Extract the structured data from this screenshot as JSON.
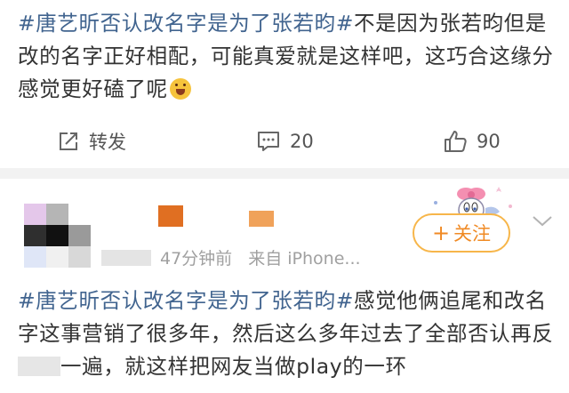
{
  "post1": {
    "topic": "#唐艺昕否认改名字是为了张若昀#",
    "body": "不是因为张若昀但是改的名字正好相配，可能真爱就是这样吧，这巧合这缘分感觉更好磕了呢",
    "emoji": "grinning-face-emoji"
  },
  "actions": {
    "repost_label": "转发",
    "comment_count": "20",
    "like_count": "90",
    "repost_icon": "share-icon",
    "comment_icon": "comment-icon",
    "like_icon": "thumbs-up-icon"
  },
  "post2": {
    "meta_time": "47分钟前",
    "meta_source": "来自 iPhone...",
    "follow_label": "关注",
    "topic": "#唐艺昕否认改名字是为了张若昀#",
    "body_before_mosaic": "感觉他俩追尾和改名字这事营销了很多年，然后这么多年过去了全部否认再反",
    "body_after_mosaic": "一遍，就这样把网友当做play的一环",
    "avatar_colors": [
      "#e4c7ea",
      "#b5b5b5",
      "#ffffff",
      "#2f2f2f",
      "#111111",
      "#9a9a9a",
      "#dfe6f7",
      "#f0f0f0",
      "#d8d8d8"
    ]
  }
}
